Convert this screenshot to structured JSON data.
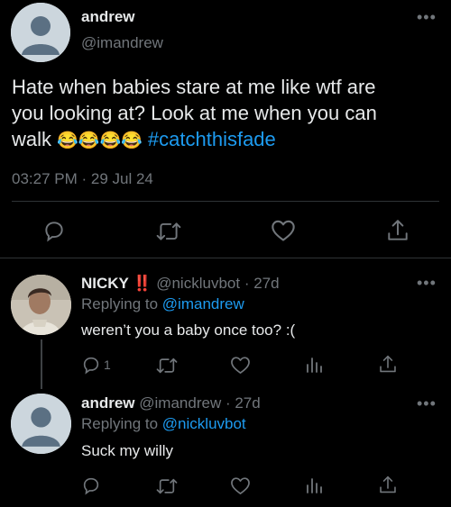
{
  "main_tweet": {
    "display_name": "andrew",
    "handle": "@imandrew",
    "text_line1": "Hate when babies stare at me like wtf are",
    "text_line2": "you looking at? Look at me when you can",
    "text_line3_prefix": "walk",
    "emoji": "😂😂😂😂",
    "hashtag": "#catchthisfade",
    "timestamp": "03:27 PM · 29 Jul 24",
    "more_icon": "more-dots-icon"
  },
  "actions": {
    "reply_icon": "reply-icon",
    "retweet_icon": "retweet-icon",
    "like_icon": "heart-icon",
    "share_icon": "share-icon",
    "views_icon": "views-icon"
  },
  "replies": [
    {
      "display_name": "NICKY ‼️",
      "handle": "@nickluvbot",
      "age": "· 27d",
      "replying_prefix": "Replying to",
      "replying_to": "@imandrew",
      "text": "weren’t you a baby once too? :(",
      "reply_count": "1"
    },
    {
      "display_name": "andrew",
      "handle": "@imandrew",
      "age": "· 27d",
      "replying_prefix": "Replying to",
      "replying_to": "@nickluvbot",
      "text": "Suck my willy",
      "reply_count": ""
    }
  ],
  "colors": {
    "background": "#000000",
    "text": "#e7e9ea",
    "muted": "#71767b",
    "link": "#1d9bf0",
    "separator": "#2f3336"
  }
}
